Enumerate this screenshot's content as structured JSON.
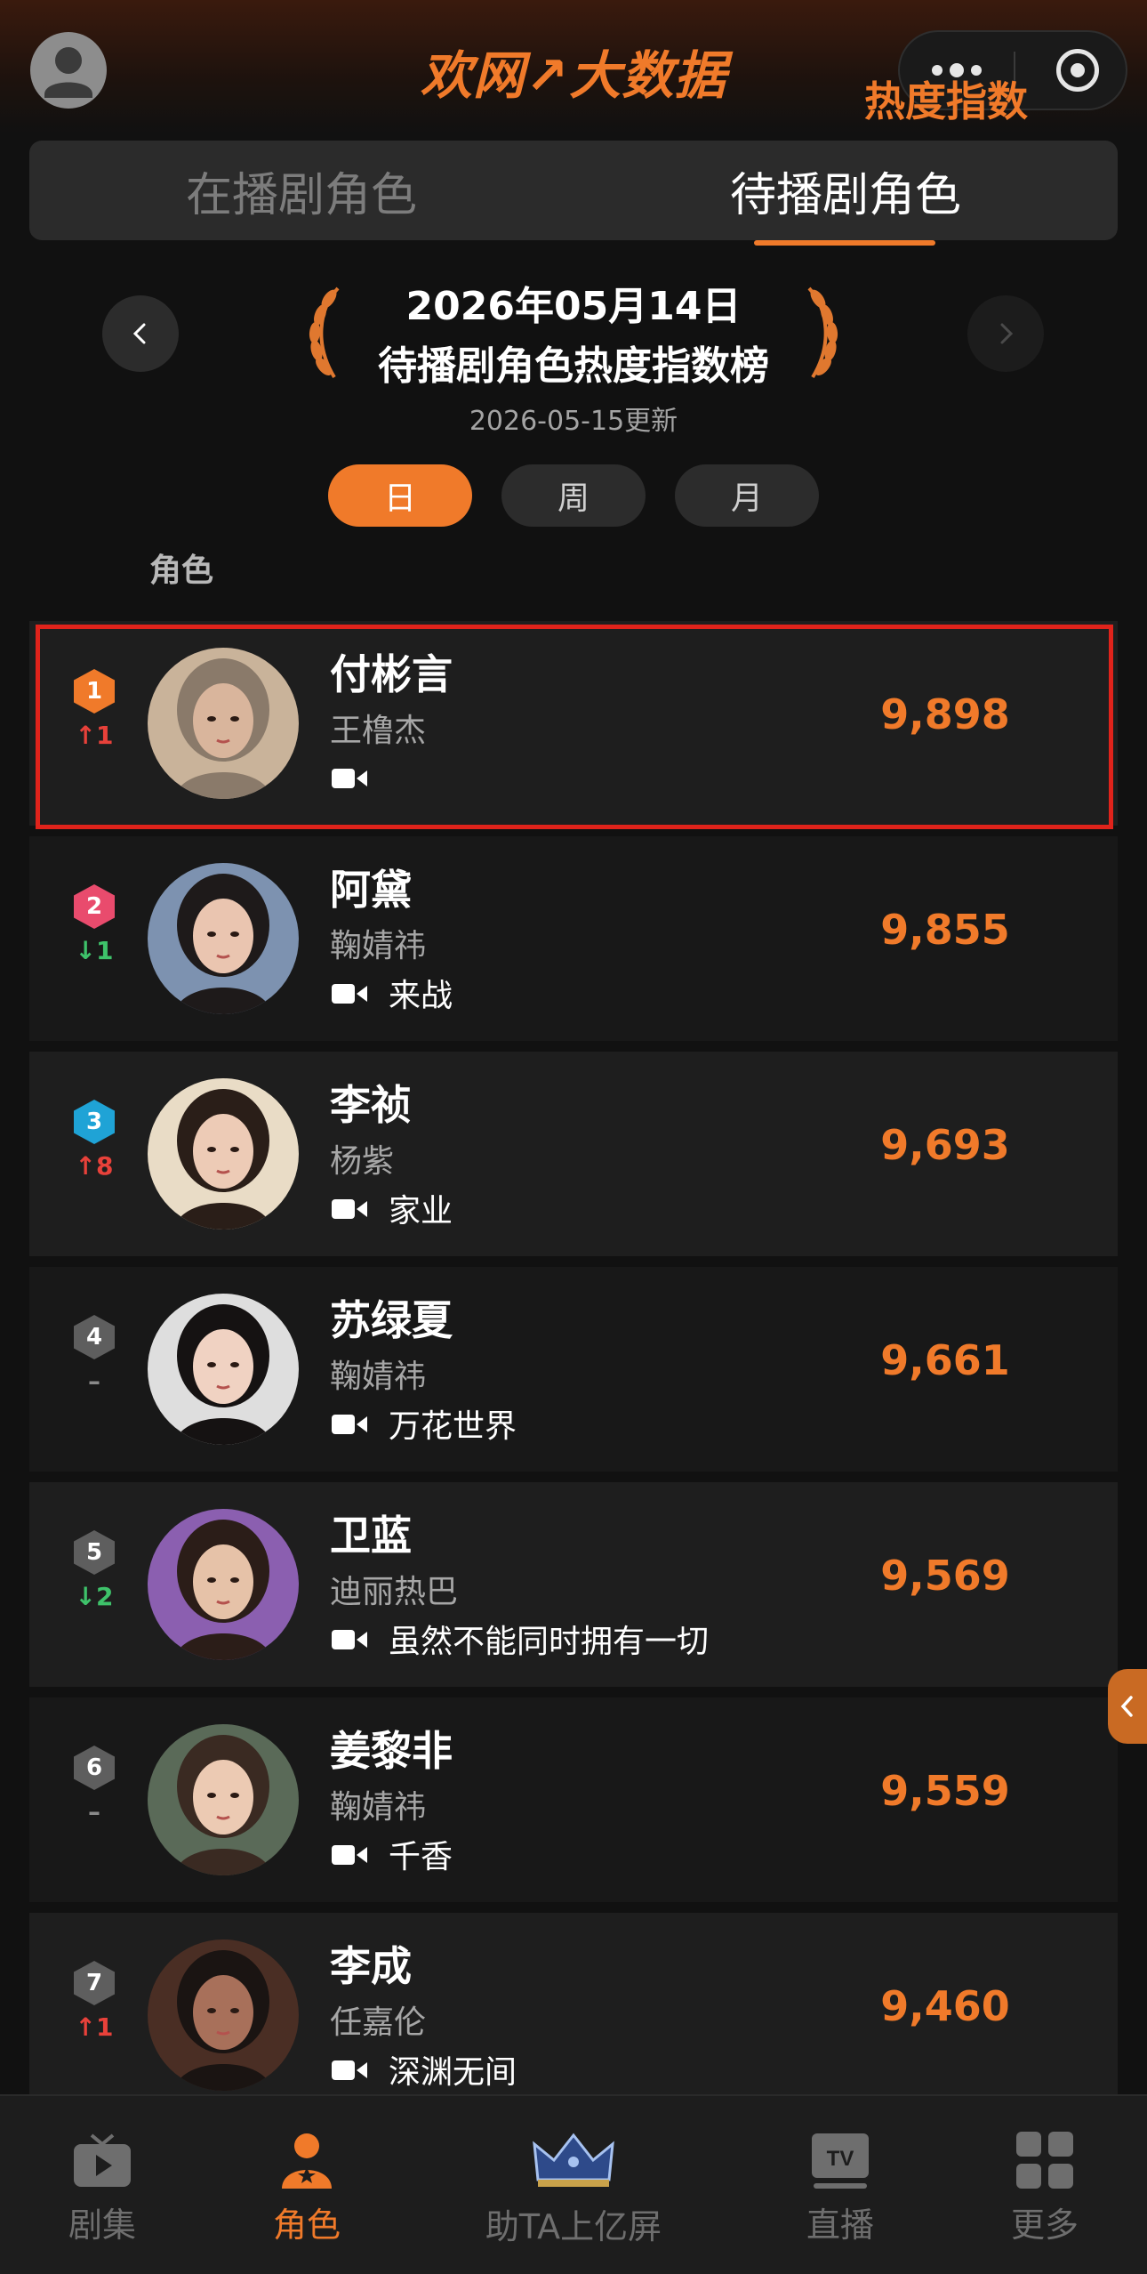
{
  "header": {
    "app_title": "欢网↗大数据"
  },
  "tabs": {
    "airing": "在播剧角色",
    "upcoming": "待播剧角色",
    "active": "upcoming"
  },
  "ranking": {
    "date": "2026年05月14日",
    "title": "待播剧角色热度指数榜",
    "updated": "2026-05-15更新",
    "periods": [
      "日",
      "周",
      "月"
    ],
    "selected_period": "日",
    "col_role": "角色",
    "col_score": "热度指数"
  },
  "rows": [
    {
      "rank": "1",
      "change": "↑1",
      "dir": "up",
      "name": "付彬言",
      "actor": "王橹杰",
      "drama": "",
      "score": "9,898",
      "hex_color": "#f07a2a",
      "highlighted": true
    },
    {
      "rank": "2",
      "change": "↓1",
      "dir": "down",
      "name": "阿黛",
      "actor": "鞠婧祎",
      "drama": "来战",
      "score": "9,855",
      "hex_color": "#e94b6d"
    },
    {
      "rank": "3",
      "change": "↑8",
      "dir": "up",
      "name": "李祯",
      "actor": "杨紫",
      "drama": "家业",
      "score": "9,693",
      "hex_color": "#1fa3d6"
    },
    {
      "rank": "4",
      "change": "–",
      "dir": "same",
      "name": "苏绿夏",
      "actor": "鞠婧祎",
      "drama": "万花世界",
      "score": "9,661",
      "hex_color": "#5e5e5e"
    },
    {
      "rank": "5",
      "change": "↓2",
      "dir": "down",
      "name": "卫蓝",
      "actor": "迪丽热巴",
      "drama": "虽然不能同时拥有一切",
      "score": "9,569",
      "hex_color": "#5e5e5e"
    },
    {
      "rank": "6",
      "change": "–",
      "dir": "same",
      "name": "姜黎非",
      "actor": "鞠婧祎",
      "drama": "千香",
      "score": "9,559",
      "hex_color": "#5e5e5e"
    },
    {
      "rank": "7",
      "change": "↑1",
      "dir": "up",
      "name": "李成",
      "actor": "任嘉伦",
      "drama": "深渊无间",
      "score": "9,460",
      "hex_color": "#5e5e5e"
    }
  ],
  "bottom_nav": [
    {
      "label": "剧集",
      "icon": "play-icon"
    },
    {
      "label": "角色",
      "icon": "role-icon",
      "active": true
    },
    {
      "label": "助TA上亿屏",
      "icon": "crown-icon"
    },
    {
      "label": "直播",
      "icon": "tv-icon"
    },
    {
      "label": "更多",
      "icon": "grid-icon"
    }
  ],
  "colors": {
    "accent": "#f07a2a",
    "background": "#111111",
    "up": "#e8413a",
    "down": "#3ec26a",
    "highlight_border": "#e0231b"
  }
}
